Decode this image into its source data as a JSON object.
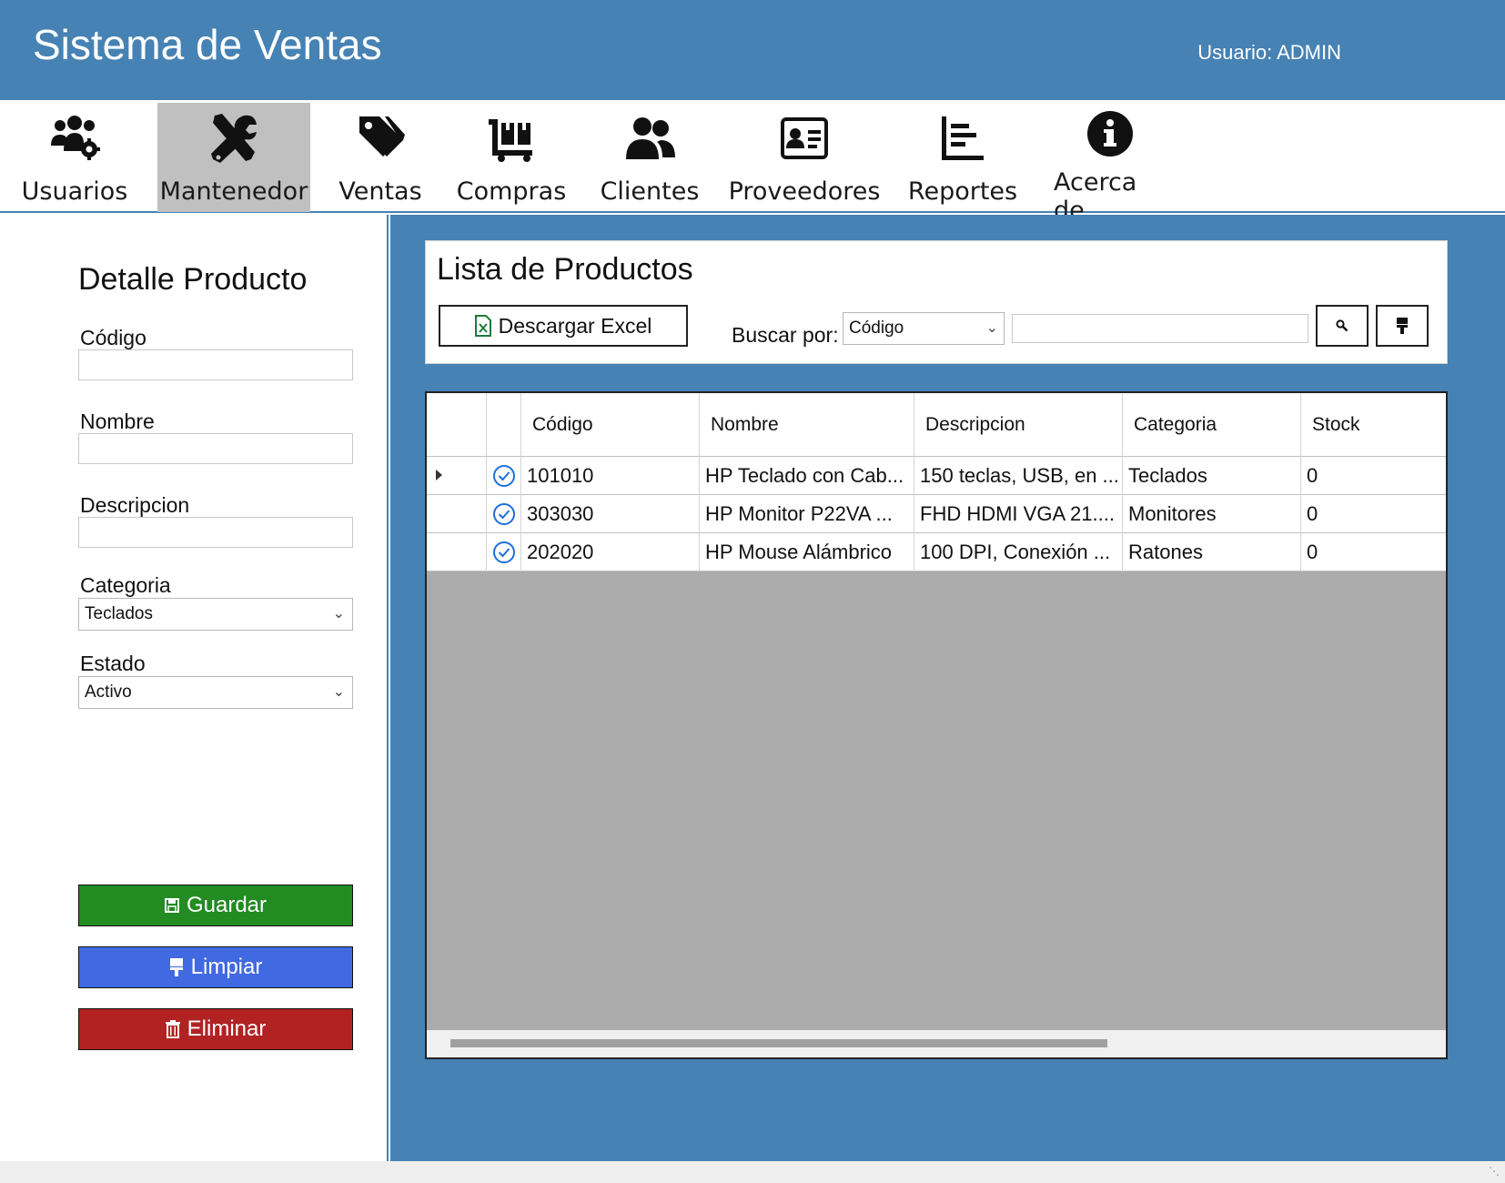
{
  "header": {
    "title": "Sistema de Ventas",
    "user": "Usuario: ADMIN"
  },
  "menu": {
    "items": [
      {
        "label": "Usuarios",
        "icon": "users-gear-icon"
      },
      {
        "label": "Mantenedor",
        "icon": "tools-icon",
        "active": true
      },
      {
        "label": "Ventas",
        "icon": "tags-icon"
      },
      {
        "label": "Compras",
        "icon": "dolly-icon"
      },
      {
        "label": "Clientes",
        "icon": "user-friends-icon"
      },
      {
        "label": "Proveedores",
        "icon": "address-card-icon"
      },
      {
        "label": "Reportes",
        "icon": "chart-list-icon"
      },
      {
        "label": "Acerca de",
        "icon": "info-circle-icon"
      }
    ]
  },
  "detalle": {
    "title": "Detalle Producto",
    "codigo_label": "Código",
    "codigo_value": "",
    "nombre_label": "Nombre",
    "nombre_value": "",
    "descripcion_label": "Descripcion",
    "descripcion_value": "",
    "categoria_label": "Categoria",
    "categoria_value": "Teclados",
    "estado_label": "Estado",
    "estado_value": "Activo",
    "guardar": "Guardar",
    "limpiar": "Limpiar",
    "eliminar": "Eliminar"
  },
  "lista": {
    "title": "Lista de Productos",
    "excel_button": "Descargar Excel",
    "buscar_label": "Buscar por:",
    "buscar_option": "Código",
    "buscar_value": ""
  },
  "grid": {
    "columns": [
      "Código",
      "Nombre",
      "Descripcion",
      "Categoria",
      "Stock"
    ],
    "rows": [
      {
        "codigo": "101010",
        "nombre": "HP Teclado con Cab...",
        "descripcion": "150 teclas, USB, en ...",
        "categoria": "Teclados",
        "stock": "0"
      },
      {
        "codigo": "303030",
        "nombre": "HP Monitor P22VA ...",
        "descripcion": "FHD HDMI VGA 21....",
        "categoria": "Monitores",
        "stock": "0"
      },
      {
        "codigo": "202020",
        "nombre": "HP Mouse Alámbrico",
        "descripcion": "100 DPI, Conexión ...",
        "categoria": "Ratones",
        "stock": "0"
      }
    ]
  },
  "colors": {
    "primary": "#4682b4",
    "guardar": "#228b22",
    "limpiar": "#4169e1",
    "eliminar": "#b22222",
    "menu_active": "#c0c0c0"
  }
}
